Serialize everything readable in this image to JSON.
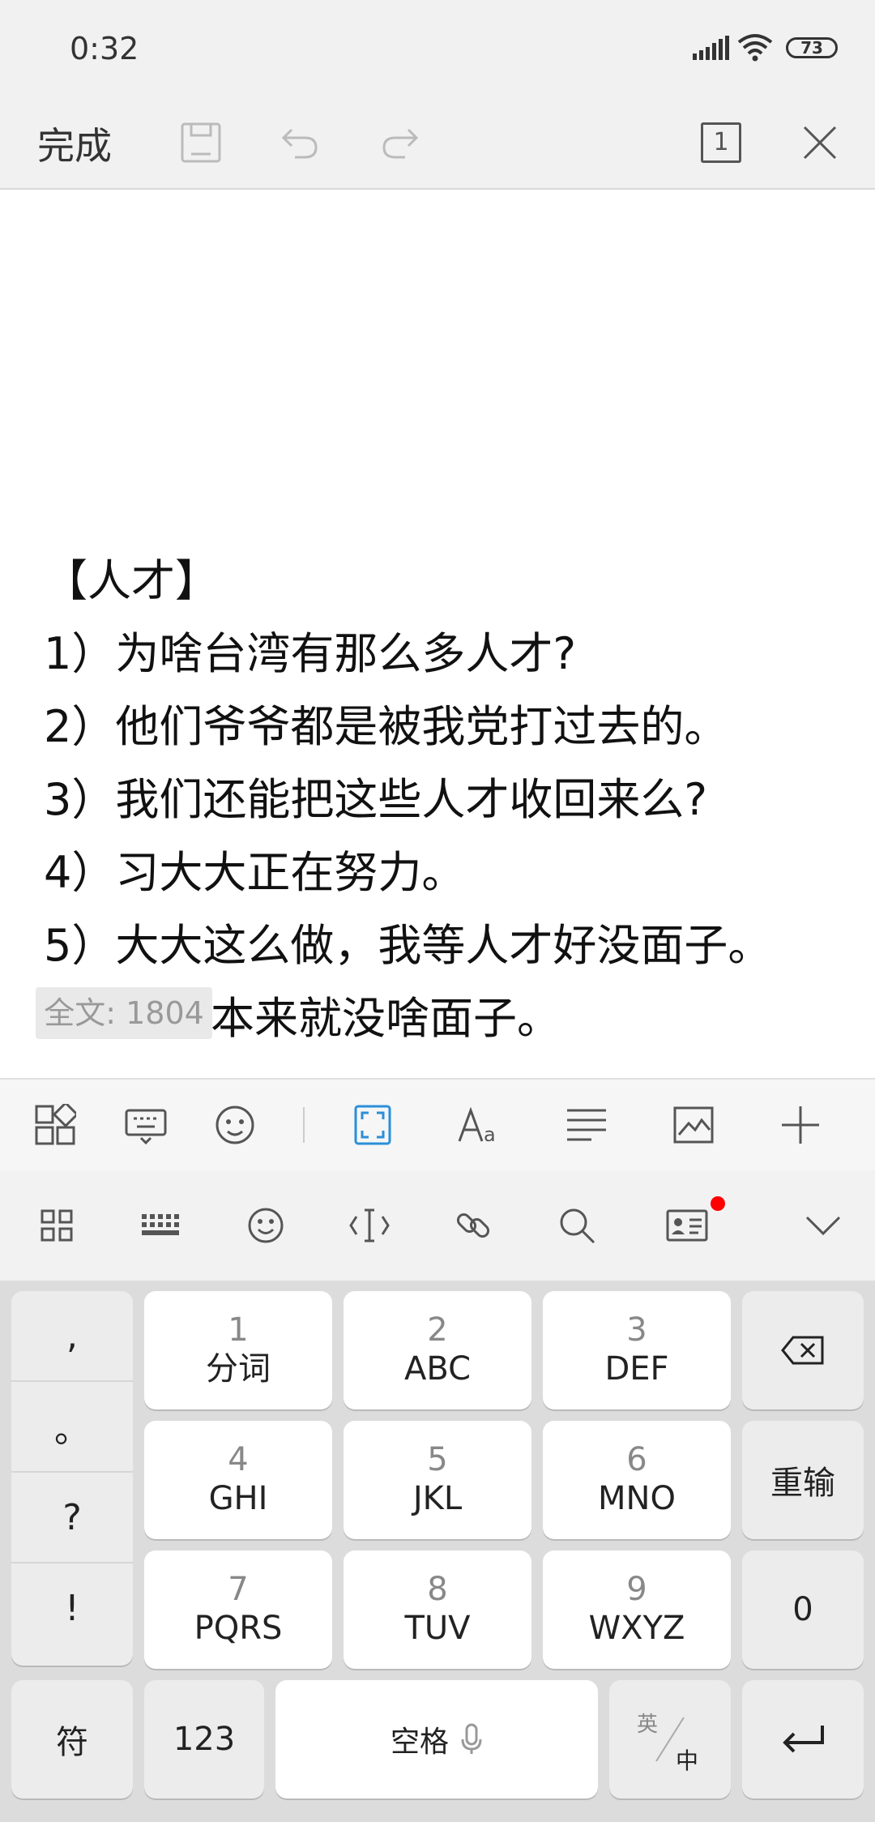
{
  "status": {
    "time": "0:32",
    "battery": "73"
  },
  "toolbar": {
    "done": "完成",
    "page_count": "1"
  },
  "document": {
    "lines": [
      "【人才】",
      "1）为啥台湾有那么多人才?",
      "2）他们爷爷都是被我党打过去的。",
      "3）我们还能把这些人才收回来么?",
      "4）习大大正在努力。",
      "5）大大这么做，我等人才好没面子。",
      "本来就没啥面子。"
    ],
    "word_count": "全文: 1804"
  },
  "keyboard": {
    "punct": [
      ",",
      "。",
      "?",
      "!"
    ],
    "keys": [
      {
        "num": "1",
        "label": "分词"
      },
      {
        "num": "2",
        "label": "ABC"
      },
      {
        "num": "3",
        "label": "DEF"
      },
      {
        "num": "4",
        "label": "GHI"
      },
      {
        "num": "5",
        "label": "JKL"
      },
      {
        "num": "6",
        "label": "MNO"
      },
      {
        "num": "7",
        "label": "PQRS"
      },
      {
        "num": "8",
        "label": "TUV"
      },
      {
        "num": "9",
        "label": "WXYZ"
      }
    ],
    "retype": "重输",
    "zero": "0",
    "symbol": "符",
    "num123": "123",
    "space": "空格",
    "lang_en": "英",
    "lang_zh": "中"
  }
}
